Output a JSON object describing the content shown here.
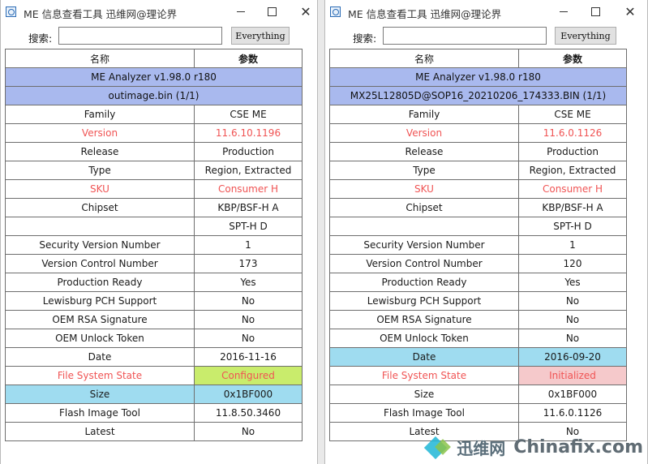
{
  "windows": [
    {
      "title": "ME 信息查看工具   迅维网@理论界",
      "search": {
        "label": "搜索:",
        "value": "",
        "button": "Everything"
      },
      "header": {
        "col1": "名称",
        "col2": "参数"
      },
      "banner1": "ME Analyzer v1.98.0 r180",
      "banner2": "outimage.bin (1/1)",
      "rows": [
        {
          "name": "Family",
          "value": "CSE ME"
        },
        {
          "name": "Version",
          "value": "11.6.10.1196"
        },
        {
          "name": "Release",
          "value": "Production"
        },
        {
          "name": "Type",
          "value": "Region, Extracted"
        },
        {
          "name": "SKU",
          "value": "Consumer H"
        },
        {
          "name": "Chipset",
          "value": "KBP/BSF-H A"
        },
        {
          "name": "",
          "value": "SPT-H D"
        },
        {
          "name": "Security Version Number",
          "value": "1"
        },
        {
          "name": "Version Control Number",
          "value": "173"
        },
        {
          "name": "Production Ready",
          "value": "Yes"
        },
        {
          "name": "Lewisburg PCH Support",
          "value": "No"
        },
        {
          "name": "OEM RSA Signature",
          "value": "No"
        },
        {
          "name": "OEM Unlock Token",
          "value": "No"
        },
        {
          "name": "Date",
          "value": "2016-11-16"
        },
        {
          "name": "File System State",
          "value": "Configured"
        },
        {
          "name": "Size",
          "value": "0x1BF000"
        },
        {
          "name": "Flash Image Tool",
          "value": "11.8.50.3460"
        },
        {
          "name": "Latest",
          "value": "No"
        }
      ]
    },
    {
      "title": "ME 信息查看工具   迅维网@理论界",
      "search": {
        "label": "搜索:",
        "value": "",
        "button": "Everything"
      },
      "header": {
        "col1": "名称",
        "col2": "参数"
      },
      "banner1": "ME Analyzer v1.98.0 r180",
      "banner2": "MX25L12805D@SOP16_20210206_174333.BIN (1/1)",
      "rows": [
        {
          "name": "Family",
          "value": "CSE ME"
        },
        {
          "name": "Version",
          "value": "11.6.0.1126"
        },
        {
          "name": "Release",
          "value": "Production"
        },
        {
          "name": "Type",
          "value": "Region, Extracted"
        },
        {
          "name": "SKU",
          "value": "Consumer H"
        },
        {
          "name": "Chipset",
          "value": "KBP/BSF-H A"
        },
        {
          "name": "",
          "value": "SPT-H D"
        },
        {
          "name": "Security Version Number",
          "value": "1"
        },
        {
          "name": "Version Control Number",
          "value": "120"
        },
        {
          "name": "Production Ready",
          "value": "Yes"
        },
        {
          "name": "Lewisburg PCH Support",
          "value": "No"
        },
        {
          "name": "OEM RSA Signature",
          "value": "No"
        },
        {
          "name": "OEM Unlock Token",
          "value": "No"
        },
        {
          "name": "Date",
          "value": "2016-09-20"
        },
        {
          "name": "File System State",
          "value": "Initialized"
        },
        {
          "name": "Size",
          "value": "0x1BF000"
        },
        {
          "name": "Flash Image Tool",
          "value": "11.6.0.1126"
        },
        {
          "name": "Latest",
          "value": "No"
        }
      ]
    }
  ],
  "colors": {
    "banner": "#a9b9ee",
    "highlight_red_text": "#f05454",
    "cyan": "#9fdcf0",
    "green": "#c9ec6c",
    "pink": "#f5c9cb"
  },
  "watermark": {
    "cn": "迅维网",
    "en": "Chinafix.com"
  }
}
